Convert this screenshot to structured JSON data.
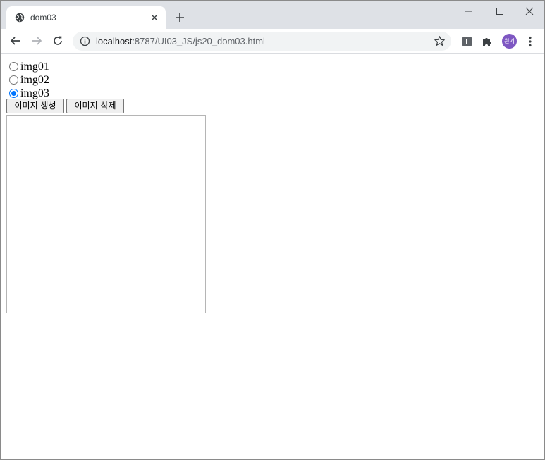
{
  "browser": {
    "tab": {
      "title": "dom03"
    },
    "url": {
      "host": "localhost",
      "rest": ":8787/UI03_JS/js20_dom03.html"
    },
    "profile": {
      "initials": "원기",
      "color": "#7e57c2"
    }
  },
  "page": {
    "radios": [
      {
        "label": "img01",
        "checked": false
      },
      {
        "label": "img02",
        "checked": false
      },
      {
        "label": "img03",
        "checked": true
      }
    ],
    "buttons": {
      "create_label": "이미지 생성",
      "delete_label": "이미지 삭제"
    }
  }
}
